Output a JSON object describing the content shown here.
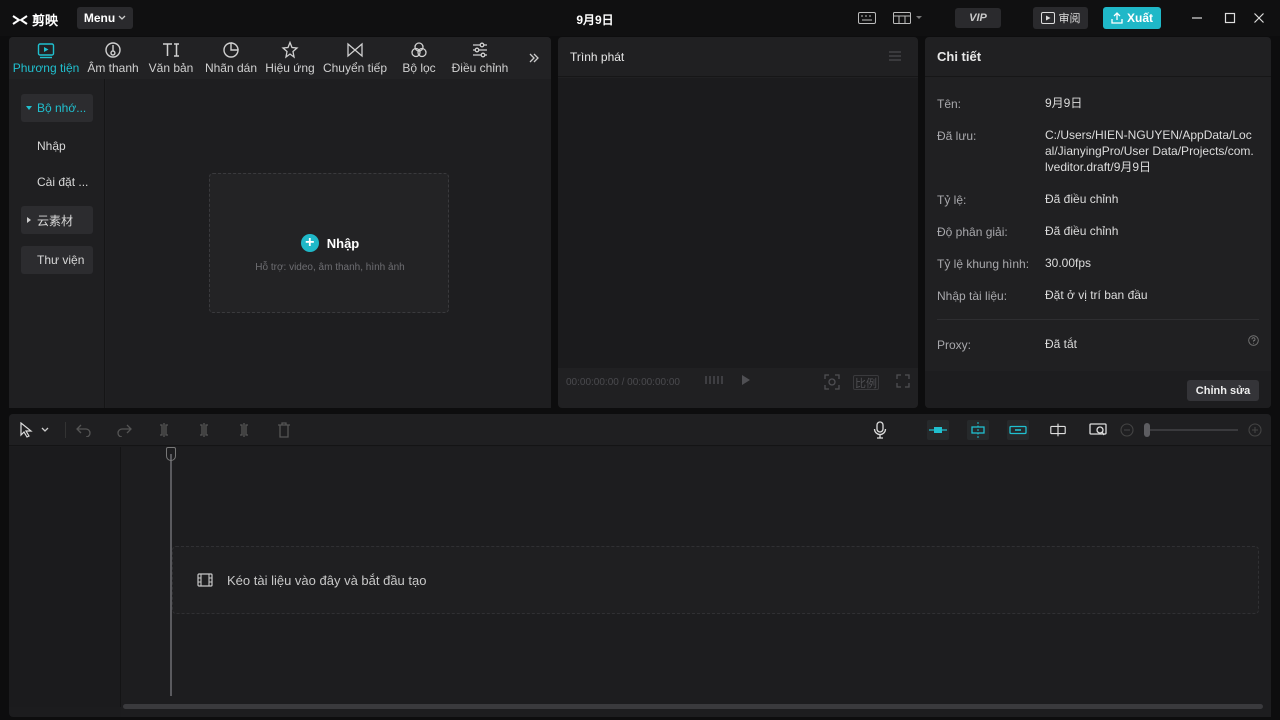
{
  "app": {
    "logo_text": "剪映",
    "menu_label": "Menu",
    "title": "9月9日",
    "vip_label": "VIP",
    "review_label": "审阅",
    "export_label": "Xuất"
  },
  "media": {
    "tools": [
      {
        "label": "Phương tiện",
        "icon": "media-icon"
      },
      {
        "label": "Âm thanh",
        "icon": "audio-icon"
      },
      {
        "label": "Văn bản",
        "icon": "text-icon"
      },
      {
        "label": "Nhãn dán",
        "icon": "sticker-icon"
      },
      {
        "label": "Hiệu ứng",
        "icon": "effects-icon"
      },
      {
        "label": "Chuyển tiếp",
        "icon": "transition-icon"
      },
      {
        "label": "Bộ lọc",
        "icon": "filter-icon"
      },
      {
        "label": "Điều chỉnh",
        "icon": "adjust-icon"
      }
    ],
    "sidebar": [
      {
        "label": "Bộ nhớ..."
      },
      {
        "label": "Nhập"
      },
      {
        "label": "Cài đặt ..."
      },
      {
        "label": "云素材"
      },
      {
        "label": "Thư viện"
      }
    ],
    "import_title": "Nhập",
    "import_subtitle": "Hỗ trợ: video, âm thanh, hình ảnh"
  },
  "player": {
    "title": "Trình phát",
    "timecode": "00:00:00:00 / 00:00:00:00",
    "ratio_label": "比例"
  },
  "details": {
    "title": "Chi tiết",
    "rows": [
      {
        "label": "Tên:",
        "value": "9月9日"
      },
      {
        "label": "Đã lưu:",
        "value": "C:/Users/HIEN-NGUYEN/AppData/Local/JianyingPro/User Data/Projects/com.lveditor.draft/9月9日"
      },
      {
        "label": "Tỷ lệ:",
        "value": "Đã điều chỉnh"
      },
      {
        "label": "Độ phân giải:",
        "value": "Đã điều chỉnh"
      },
      {
        "label": "Tỷ lệ khung hình:",
        "value": "30.00fps"
      },
      {
        "label": "Nhập tài liệu:",
        "value": "Đặt ở vị trí ban đầu"
      },
      {
        "label": "Proxy:",
        "value": "Đã tắt"
      }
    ],
    "edit_label": "Chỉnh sửa"
  },
  "timeline": {
    "drop_text": "Kéo tài liệu vào đây và bắt đầu tạo"
  },
  "colors": {
    "accent": "#1fb8c8",
    "panel": "#202022",
    "background": "#0d0d0e"
  }
}
